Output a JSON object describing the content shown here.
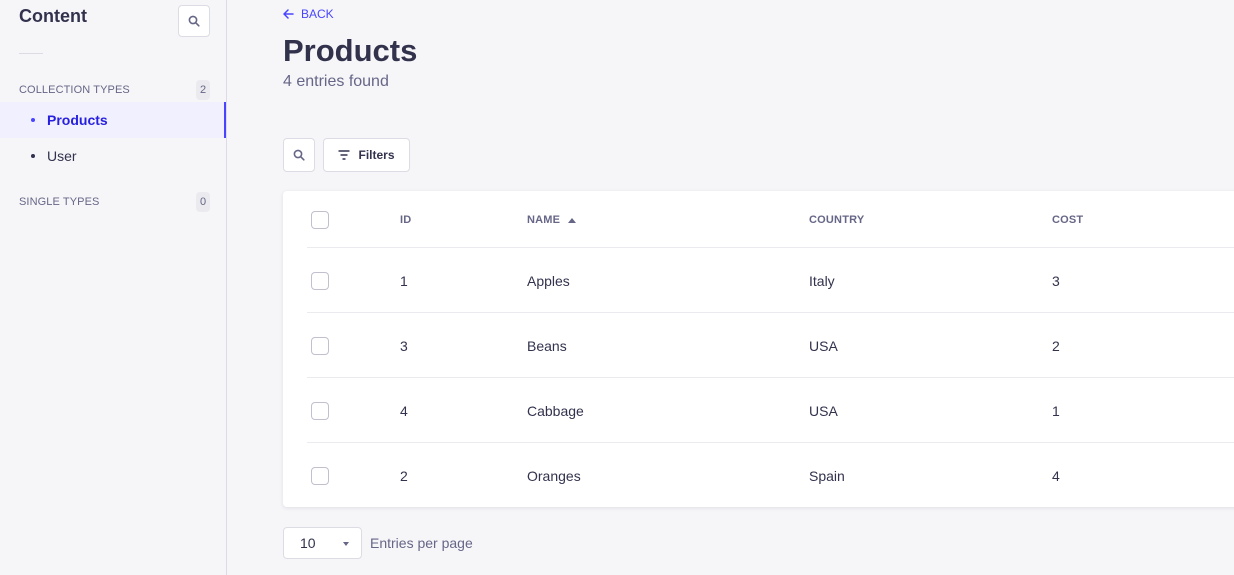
{
  "sidebar": {
    "title": "Content",
    "collection_types": {
      "label": "COLLECTION TYPES",
      "count": "2"
    },
    "items": [
      {
        "label": "Products",
        "active": true
      },
      {
        "label": "User",
        "active": false
      }
    ],
    "single_types": {
      "label": "SINGLE TYPES",
      "count": "0"
    }
  },
  "header": {
    "back_label": "BACK",
    "title": "Products",
    "subtitle": "4 entries found"
  },
  "toolbar": {
    "filters_label": "Filters"
  },
  "table": {
    "columns": [
      "ID",
      "NAME",
      "COUNTRY",
      "COST"
    ],
    "rows": [
      {
        "id": "1",
        "name": "Apples",
        "country": "Italy",
        "cost": "3"
      },
      {
        "id": "3",
        "name": "Beans",
        "country": "USA",
        "cost": "2"
      },
      {
        "id": "4",
        "name": "Cabbage",
        "country": "USA",
        "cost": "1"
      },
      {
        "id": "2",
        "name": "Oranges",
        "country": "Spain",
        "cost": "4"
      }
    ]
  },
  "pagination": {
    "per_page_value": "10",
    "per_page_label": "Entries per page"
  },
  "colors": {
    "accent": "#4945ff",
    "background": "#f6f6f9",
    "text": "#32324d",
    "muted": "#666687"
  }
}
